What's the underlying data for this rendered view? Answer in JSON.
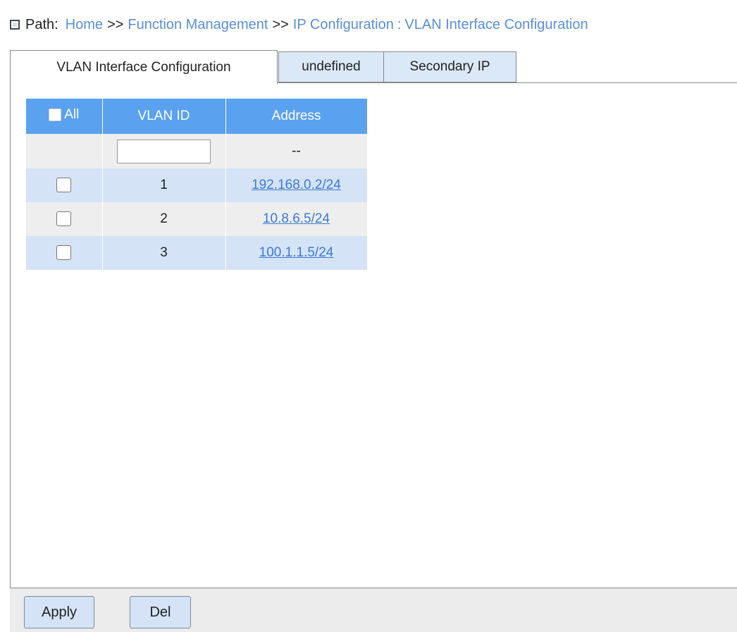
{
  "breadcrumb": {
    "prefix": "Path:",
    "items": [
      "Home",
      "Function Management",
      "IP Configuration"
    ],
    "separator": ">>",
    "current": "VLAN Interface Configuration",
    "current_sep": ":"
  },
  "tabs": [
    {
      "label": "VLAN Interface Configuration",
      "active": true
    },
    {
      "label": "undefined",
      "active": false
    },
    {
      "label": "Secondary IP",
      "active": false
    }
  ],
  "table": {
    "headers": {
      "all": "All",
      "vlan_id": "VLAN ID",
      "address": "Address"
    },
    "filter": {
      "vlan_id_value": "",
      "address_placeholder": "--"
    },
    "rows": [
      {
        "checked": false,
        "vlan_id": "1",
        "address": "192.168.0.2/24"
      },
      {
        "checked": false,
        "vlan_id": "2",
        "address": "10.8.6.5/24"
      },
      {
        "checked": false,
        "vlan_id": "3",
        "address": "100.1.1.5/24"
      }
    ]
  },
  "buttons": {
    "apply": "Apply",
    "del": "Del"
  },
  "colors": {
    "header_blue": "#5aa1ef",
    "row_blue": "#d5e3f6",
    "row_gray": "#eeeeee",
    "link": "#5a8fd6"
  }
}
